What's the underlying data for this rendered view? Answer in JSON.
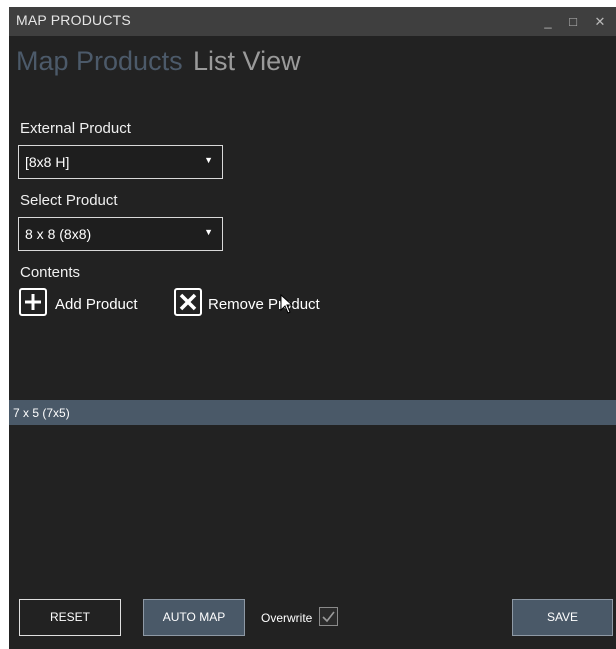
{
  "window": {
    "title": "MAP PRODUCTS",
    "minimize_glyph": "_",
    "maximize_glyph": "□",
    "close_glyph": "✕"
  },
  "tabs": [
    {
      "label": "Map Products",
      "active": true
    },
    {
      "label": "List View",
      "active": false
    }
  ],
  "form": {
    "external_product_label": "External Product",
    "external_product_value": "[8x8 H]",
    "select_product_label": "Select Product",
    "select_product_value": "8 x 8 (8x8)",
    "contents_label": "Contents",
    "add_product_label": "Add Product",
    "remove_product_label": "Remove Product"
  },
  "contents_list": [
    "7 x 5 (7x5)"
  ],
  "footer": {
    "reset_label": "RESET",
    "auto_map_label": "AUTO MAP",
    "overwrite_label": "Overwrite",
    "overwrite_checked": true,
    "save_label": "SAVE"
  },
  "colors": {
    "window_bg": "#222222",
    "titlebar_bg": "#3f3f3f",
    "accent": "#4a5968",
    "active_tab": "#4c5a6a"
  },
  "icons": {
    "add": "plus-icon",
    "remove": "x-icon",
    "dropdown": "caret-down-icon",
    "check": "checkmark-icon"
  }
}
